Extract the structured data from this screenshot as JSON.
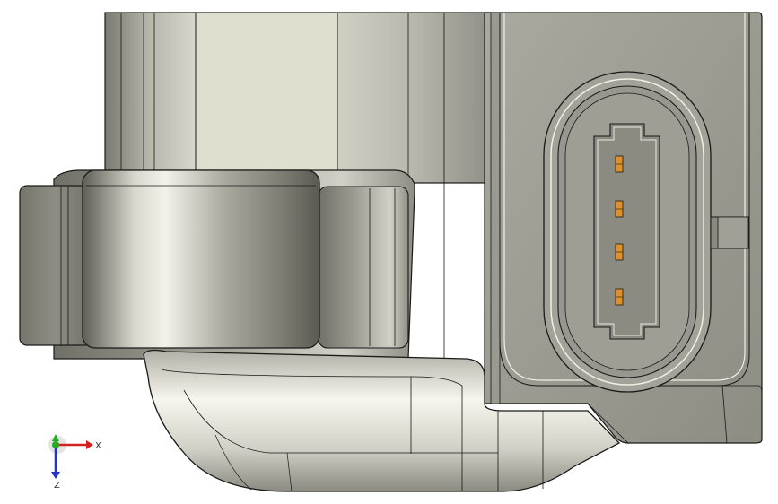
{
  "colors": {
    "background": "#ffffff",
    "body_light": "#c4c4ba",
    "body_mid": "#a6a69b",
    "body_dark": "#6f6f66",
    "edge": "#1a1a18",
    "highlight": "#f4f4ec",
    "pin": "#e0902a",
    "axis_x": "#d42020",
    "axis_y": "#22aa22",
    "axis_z": "#2233cc"
  },
  "triad": {
    "x_label": "X",
    "z_label": "Z"
  },
  "connector": {
    "pins": 4
  }
}
